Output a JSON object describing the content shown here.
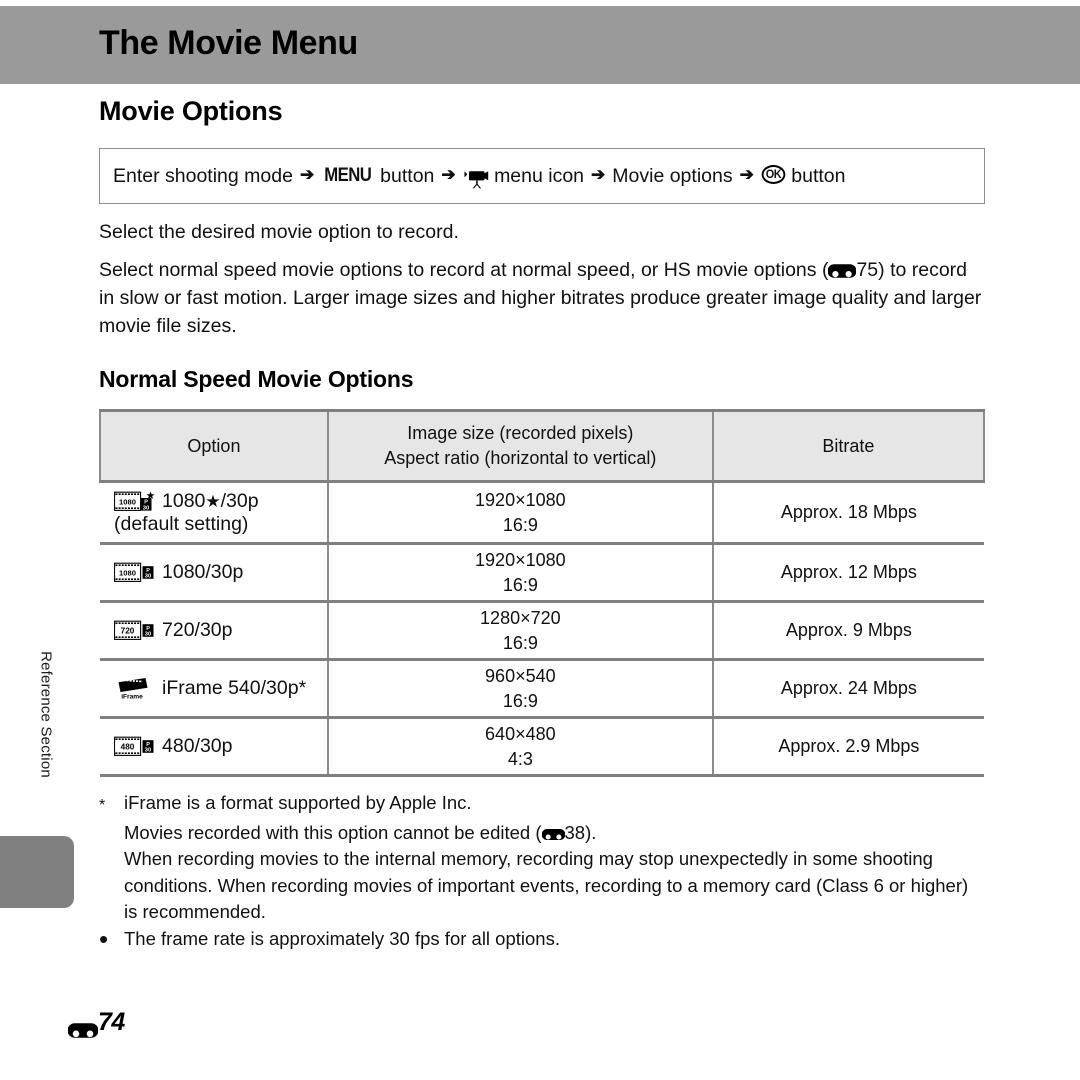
{
  "chapter": {
    "title": "The Movie Menu"
  },
  "side": {
    "label": "Reference Section"
  },
  "section": {
    "title": "Movie Options"
  },
  "navbox": {
    "step1": "Enter shooting mode",
    "menu_button_label": "MENU",
    "step2_suffix": "button",
    "menu_icon_name": "movie-menu-icon",
    "step3": "menu icon",
    "step4": "Movie options",
    "ok_button_label": "OK",
    "step5_suffix": "button",
    "arrow": "➔"
  },
  "intro": {
    "line1": "Select the desired movie option to record.",
    "para_a": "Select normal speed movie options to record at normal speed, or HS movie options (",
    "ref_page_1": "75",
    "para_b": ") to record in slow or fast motion. Larger image sizes and higher bitrates produce greater image quality and larger movie file sizes."
  },
  "subsection": {
    "title": "Normal Speed Movie Options"
  },
  "table": {
    "headers": {
      "option": "Option",
      "image_size_line1": "Image size (recorded pixels)",
      "image_size_line2": "Aspect ratio (horizontal to vertical)",
      "bitrate": "Bitrate"
    },
    "rows": [
      {
        "icon": "film-1080-star-p30-icon",
        "icon_res": "1080",
        "icon_badge_top": "P",
        "icon_badge_bottom": "30",
        "icon_star": true,
        "option_main": "1080",
        "option_star": "★",
        "option_rate": "/30p",
        "option_sub": "(default setting)",
        "size": "1920×1080",
        "aspect": "16:9",
        "bitrate": "Approx. 18 Mbps"
      },
      {
        "icon": "film-1080-p30-icon",
        "icon_res": "1080",
        "icon_badge_top": "P",
        "icon_badge_bottom": "30",
        "icon_star": false,
        "option_main": "1080",
        "option_star": "",
        "option_rate": "/30p",
        "option_sub": "",
        "size": "1920×1080",
        "aspect": "16:9",
        "bitrate": "Approx. 12 Mbps"
      },
      {
        "icon": "film-720-p30-icon",
        "icon_res": "720",
        "icon_badge_top": "P",
        "icon_badge_bottom": "30",
        "icon_star": false,
        "option_main": "720",
        "option_star": "",
        "option_rate": "/30p",
        "option_sub": "",
        "size": "1280×720",
        "aspect": "16:9",
        "bitrate": "Approx. 9 Mbps"
      },
      {
        "icon": "iframe-icon",
        "icon_res": "iFrame",
        "icon_badge_top": "",
        "icon_badge_bottom": "",
        "icon_star": false,
        "option_main": "iFrame 540",
        "option_star": "",
        "option_rate": "/30p*",
        "option_sub": "",
        "size": "960×540",
        "aspect": "16:9",
        "bitrate": "Approx. 24 Mbps"
      },
      {
        "icon": "film-480-p30-icon",
        "icon_res": "480",
        "icon_badge_top": "P",
        "icon_badge_bottom": "30",
        "icon_star": false,
        "option_main": "480",
        "option_star": "",
        "option_rate": "/30p",
        "option_sub": "",
        "size": "640×480",
        "aspect": "4:3",
        "bitrate": "Approx. 2.9 Mbps"
      }
    ]
  },
  "notes": {
    "star_mark": "*",
    "bullet_mark": "•",
    "star_line1": "iFrame is a format supported by Apple Inc.",
    "star_line2_a": "Movies recorded with this option cannot be edited (",
    "star_line2_ref": "38",
    "star_line2_b": ").",
    "star_line3": "When recording movies to the internal memory, recording may stop unexpectedly in some shooting conditions. When recording movies of important events, recording to a memory card (Class 6 or higher) is recommended.",
    "bullet_line": "The frame rate is approximately 30 fps for all options."
  },
  "footer": {
    "page_number": "74"
  },
  "colors": {
    "chapter_band": "#9a9a9a",
    "side_tab": "#808080",
    "table_header_bg": "#e6e6e6",
    "rule": "#808080"
  }
}
